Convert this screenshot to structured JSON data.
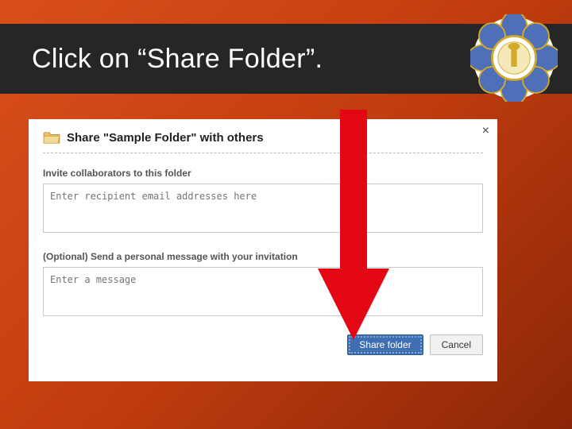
{
  "slide": {
    "title": "Click on “Share Folder”."
  },
  "dialog": {
    "title": "Share \"Sample Folder\" with others",
    "invite_label": "Invite collaborators to this folder",
    "invite_placeholder": "Enter recipient email addresses here",
    "message_label": "(Optional) Send a personal message with your invitation",
    "message_placeholder": "Enter a message",
    "share_button": "Share folder",
    "cancel_button": "Cancel",
    "close_glyph": "×"
  },
  "colors": {
    "arrow": "#E30613",
    "primary_btn": "#3f6fb0"
  }
}
